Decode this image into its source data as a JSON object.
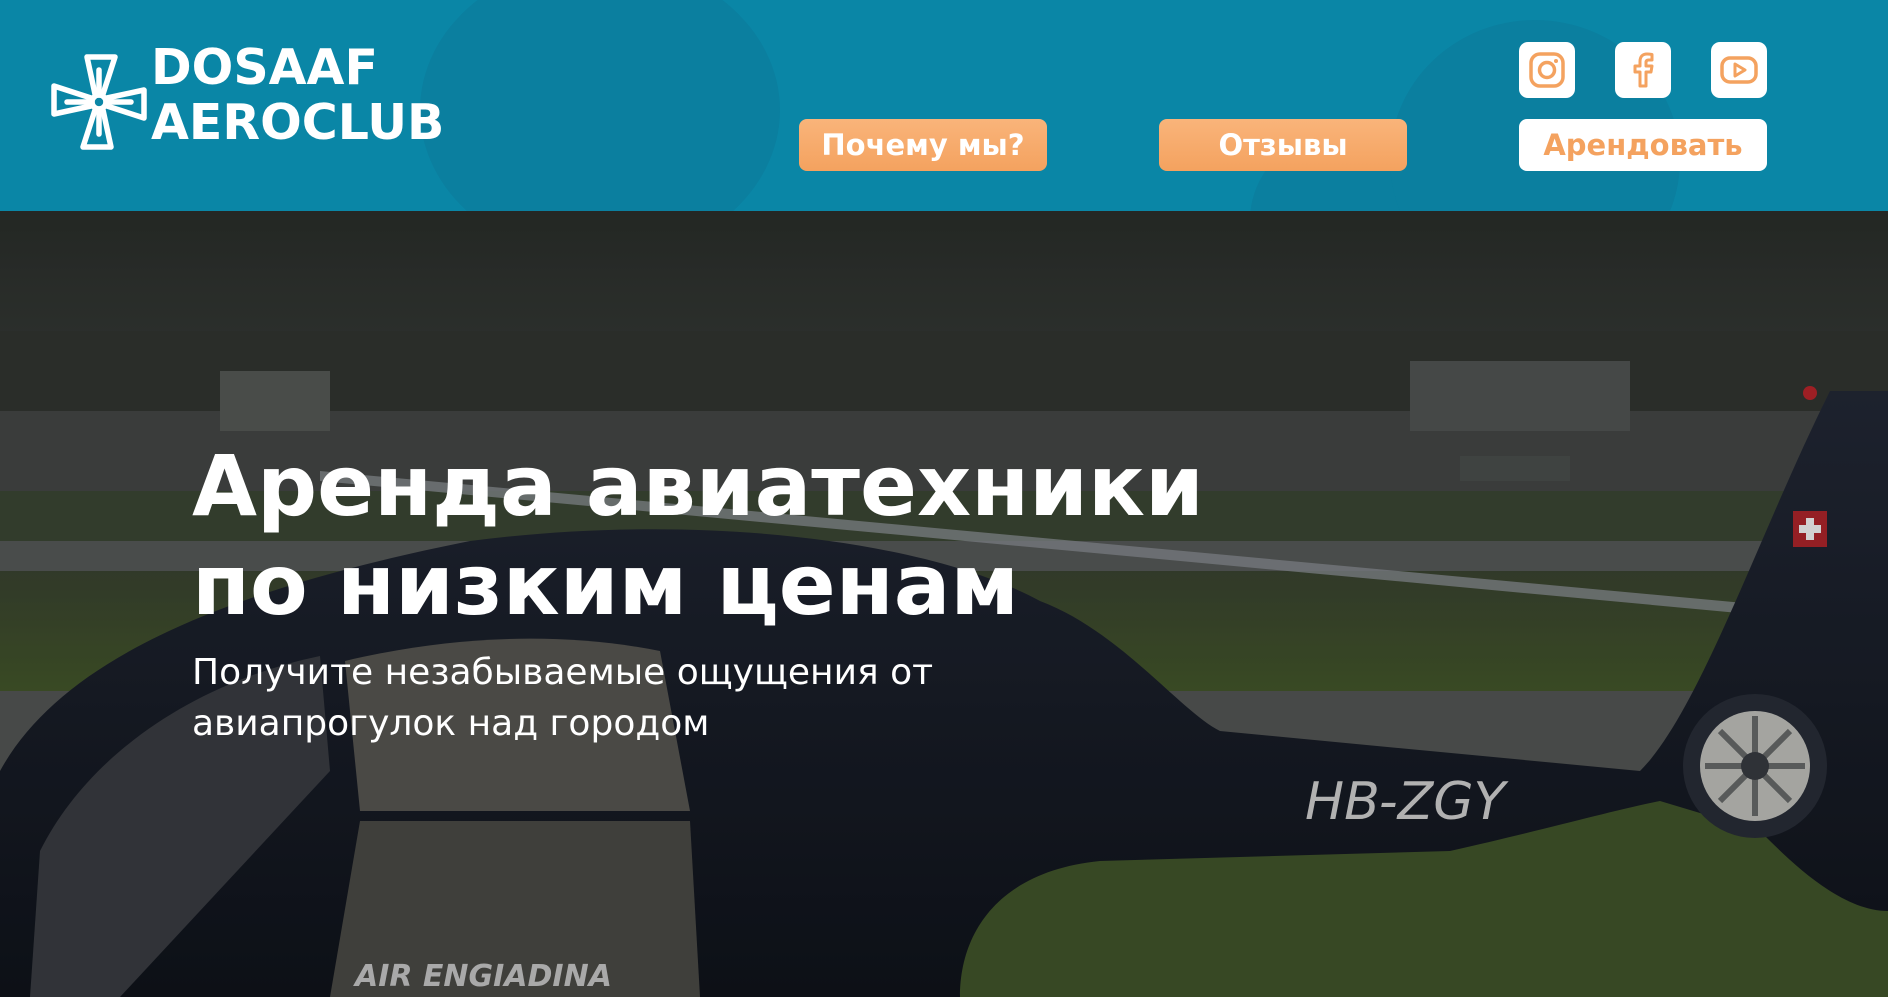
{
  "header": {
    "logo": {
      "line1": "DOSAAF",
      "line2": "AEROCLUB"
    },
    "nav": {
      "why_label": "Почему мы?",
      "reviews_label": "Отзывы",
      "rent_label": "Арендовать"
    },
    "social": [
      {
        "icon": "instagram-icon"
      },
      {
        "icon": "facebook-icon"
      },
      {
        "icon": "youtube-icon"
      }
    ]
  },
  "hero": {
    "title_line1": "Аренда авиатехники",
    "title_line2": "по низким ценам",
    "subtitle_line1": "Получите незабываемые ощущения от",
    "subtitle_line2": "авиапрогулок над городом",
    "aircraft_registration": "HB-ZGY",
    "aircraft_operator": "AIR ENGIADINA"
  },
  "colors": {
    "header_bg": "#0a86a6",
    "accent_orange": "#f4a25f",
    "text_white": "#ffffff",
    "helicopter_body": "#1a1f2c"
  }
}
